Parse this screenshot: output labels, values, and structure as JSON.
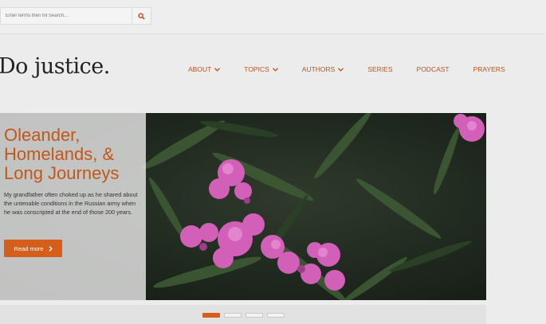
{
  "search": {
    "placeholder": "Enter terms then hit Search..."
  },
  "site": {
    "logo": "Do justice."
  },
  "nav": {
    "items": [
      {
        "label": "ABOUT",
        "dropdown": true
      },
      {
        "label": "TOPICS",
        "dropdown": true
      },
      {
        "label": "AUTHORS",
        "dropdown": true
      },
      {
        "label": "SERIES",
        "dropdown": false
      },
      {
        "label": "PODCAST",
        "dropdown": false
      },
      {
        "label": "PRAYERS",
        "dropdown": false
      }
    ]
  },
  "hero": {
    "title": "Oleander, Homelands, & Long Journeys",
    "excerpt": "My grandfather often choked up as he shared about the untenable conditions in the Russian army when he was conscripted at the end of those 200 years.",
    "button_label": "Read more",
    "slides": {
      "count": 4,
      "active": 1
    }
  },
  "colors": {
    "accent": "#d55e1a",
    "nav_text": "#b6541f",
    "title_text": "#c2571a"
  },
  "icons": {
    "search": "search-icon",
    "caret": "chevron-down-icon",
    "read_more_arrow": "chevron-right-icon"
  }
}
